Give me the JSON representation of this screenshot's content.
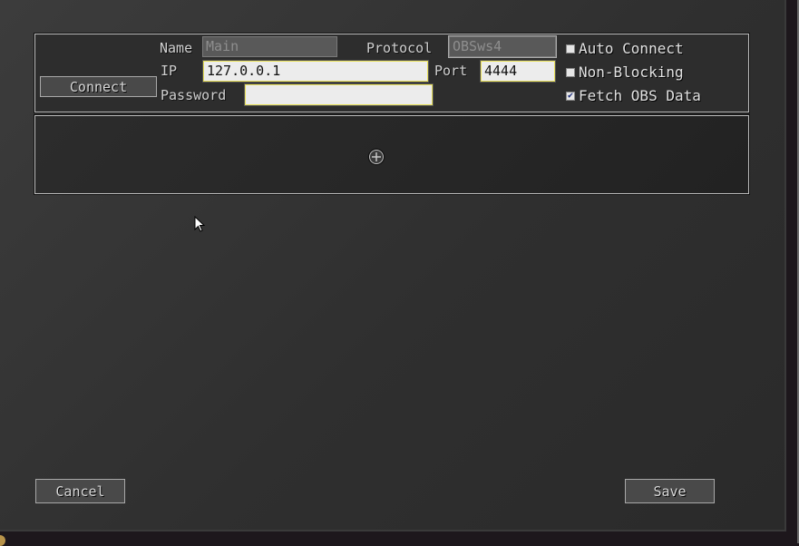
{
  "connection": {
    "connect_label": "Connect",
    "name_label": "Name",
    "name_placeholder": "Main",
    "name_value": "",
    "protocol_label": "Protocol",
    "protocol_value": "OBSws4",
    "ip_label": "IP",
    "ip_value": "127.0.0.1",
    "port_label": "Port",
    "port_value": "4444",
    "password_label": "Password",
    "password_value": "",
    "options": [
      {
        "label": "Auto Connect",
        "checked": false
      },
      {
        "label": "Non-Blocking",
        "checked": false
      },
      {
        "label": "Fetch OBS Data",
        "checked": true
      }
    ]
  },
  "scenes": {
    "add_icon": "circle-plus-icon"
  },
  "footer": {
    "cancel_label": "Cancel",
    "save_label": "Save"
  },
  "colors": {
    "field_border_active": "#e8e05a",
    "check_mark": "#1a2a7a"
  }
}
